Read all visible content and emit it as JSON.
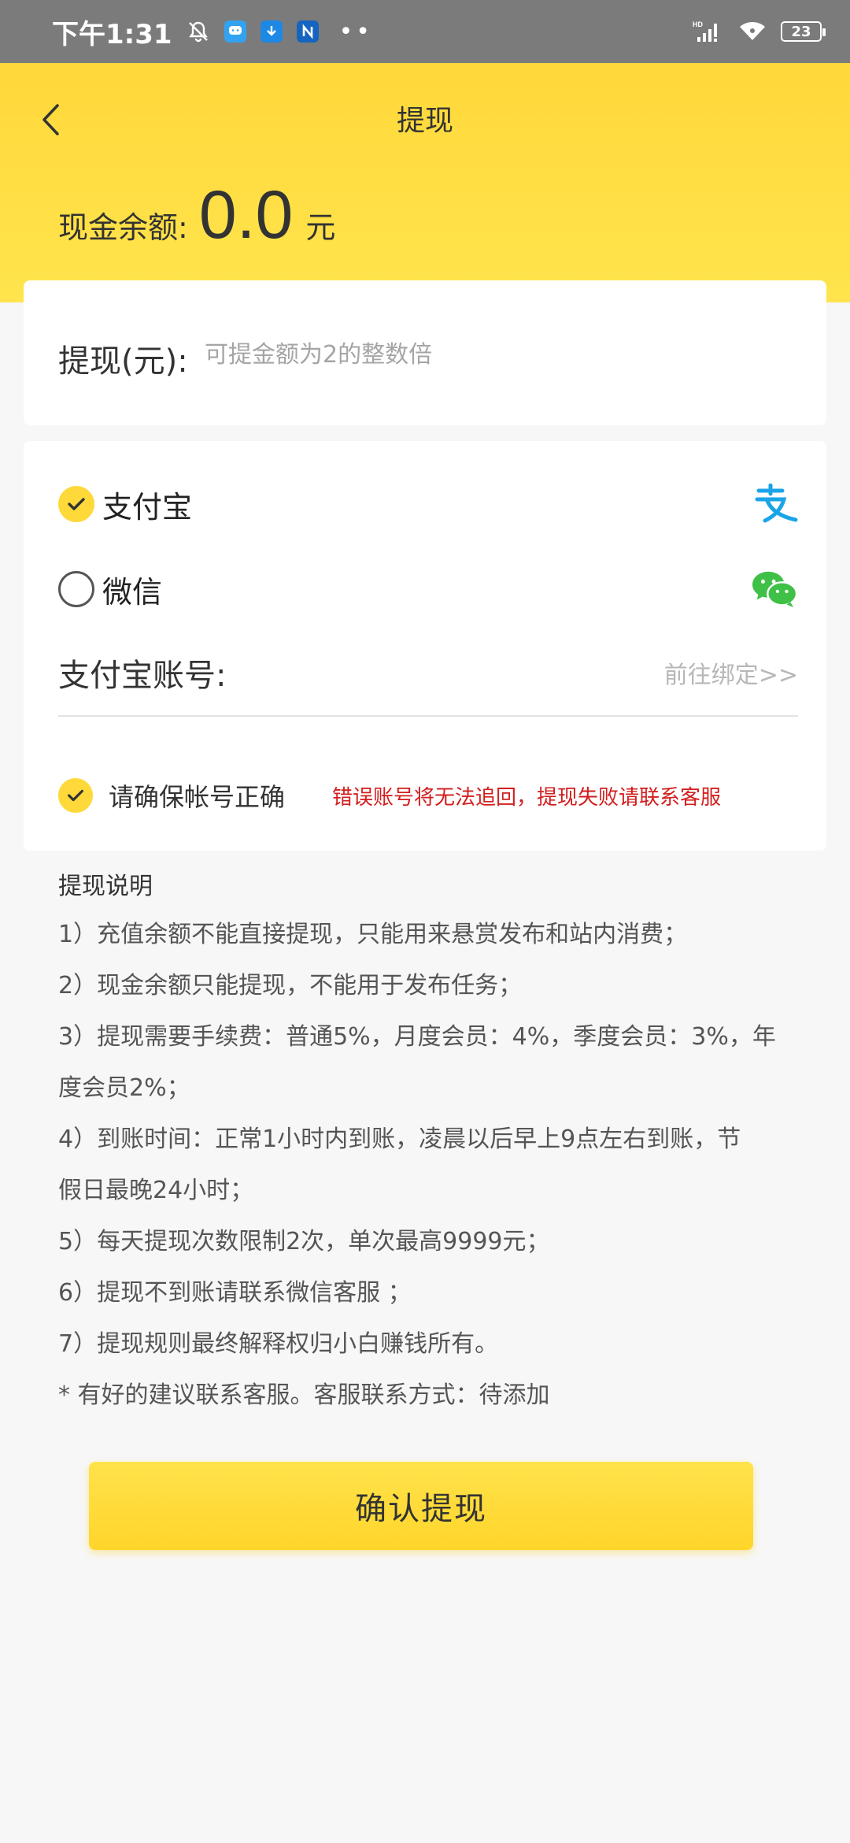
{
  "status_bar": {
    "time": "下午1:31",
    "battery": "23",
    "network_badge": "HD",
    "more": "••"
  },
  "header": {
    "title": "提现",
    "balance_label": "现金余额:",
    "balance_value": "0.0",
    "balance_unit": "元"
  },
  "amount": {
    "label": "提现(元):",
    "placeholder": "可提金额为2的整数倍",
    "value": ""
  },
  "payment": {
    "options": [
      {
        "label": "支付宝",
        "selected": true,
        "icon": "alipay-icon",
        "color": "#1ba5e8"
      },
      {
        "label": "微信",
        "selected": false,
        "icon": "wechat-icon",
        "color": "#3fc047"
      }
    ],
    "account_label": "支付宝账号:",
    "bind_link": "前往绑定>>"
  },
  "confirm": {
    "label": "请确保帐号正确",
    "checked": true,
    "warning": "错误账号将无法追回，提现失败请联系客服"
  },
  "notes": {
    "title": "提现说明",
    "items": [
      "1）充值余额不能直接提现，只能用来悬赏发布和站内消费；",
      "2）现金余额只能提现，不能用于发布任务；",
      "3）提现需要手续费：普通5%，月度会员：4%，季度会员：3%，年",
      "度会员2%；",
      "4）到账时间：正常1小时内到账，凌晨以后早上9点左右到账，节",
      "假日最晚24小时；",
      "5）每天提现次数限制2次，单次最高9999元；",
      "6）提现不到账请联系微信客服 ；",
      "7）提现规则最终解释权归小白赚钱所有。",
      "* 有好的建议联系客服。客服联系方式：待添加"
    ]
  },
  "submit": {
    "label": "确认提现"
  },
  "colors": {
    "accent": "#ffd83a",
    "warning": "#d21d1d",
    "status_bar": "#7b7b7b"
  }
}
